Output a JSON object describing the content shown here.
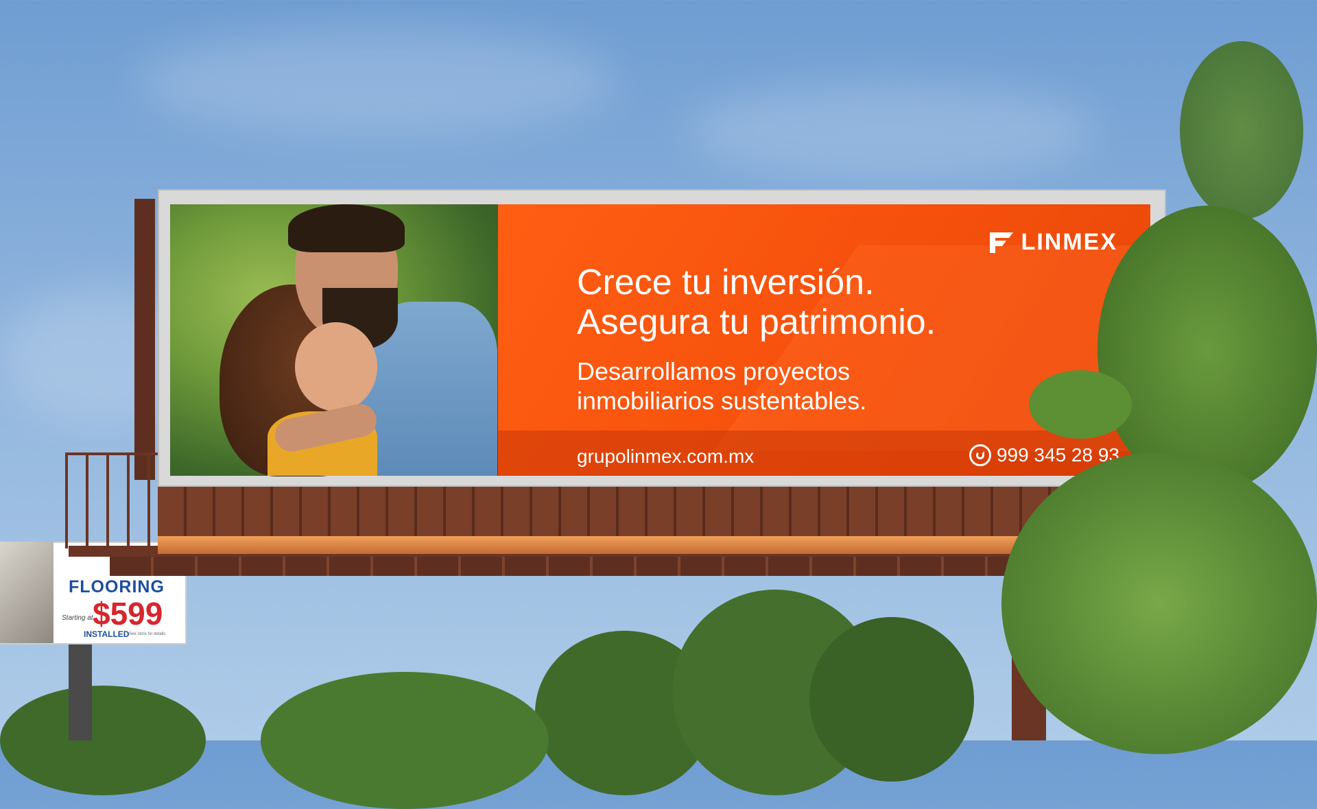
{
  "billboard": {
    "brand": "LINMEX",
    "headline": [
      "Crece tu inversión.",
      "Asegura tu patrimonio."
    ],
    "subheadline": [
      "Desarrollamos proyectos",
      "inmobiliarios sustentables."
    ],
    "website": "grupolinmex.com.mx",
    "phone": "999 345 28 93",
    "phone_icon": "whatsapp-icon",
    "accent_color": "#f5500c"
  },
  "secondary_billboard": {
    "title": "FLOORING",
    "price": "$599",
    "starting_text": "Starting at...",
    "installed_text": "INSTALLED",
    "fine_print": "See store for details",
    "title_color": "#1d4e9e",
    "price_color": "#d7262e"
  }
}
